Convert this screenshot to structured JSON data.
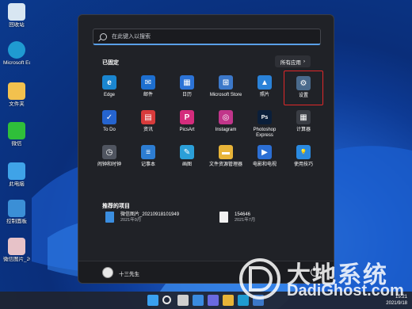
{
  "desktop": {
    "icons": [
      {
        "label": "回收站",
        "color": "#d8e6f2"
      },
      {
        "label": "Microsoft Edge",
        "color": "#1f9bd1"
      },
      {
        "label": "文件夹",
        "color": "#f2c14e"
      },
      {
        "label": "微信",
        "color": "#2fbf3a"
      },
      {
        "label": "此电脑",
        "color": "#3fa3e8"
      },
      {
        "label": "控制面板",
        "color": "#3b8fd6"
      },
      {
        "label": "微信图片_2021090",
        "color": "#e7c2c8"
      }
    ]
  },
  "start_menu": {
    "search_placeholder": "在此键入以搜索",
    "pinned_heading": "已固定",
    "all_apps_label": "所有应用",
    "all_apps_chevron": "›",
    "apps": [
      {
        "label": "Edge",
        "icon": "edge-icon",
        "color": "#1a86d0",
        "glyph": "e"
      },
      {
        "label": "邮件",
        "icon": "mail-icon",
        "color": "#1d6fd0",
        "glyph": "✉"
      },
      {
        "label": "日历",
        "icon": "calendar-icon",
        "color": "#2c73d6",
        "glyph": "▦"
      },
      {
        "label": "Microsoft Store",
        "icon": "store-icon",
        "color": "#3c78c9",
        "glyph": "⊞"
      },
      {
        "label": "照片",
        "icon": "photos-icon",
        "color": "#2a82d8",
        "glyph": "▲"
      },
      {
        "label": "设置",
        "icon": "gear-icon",
        "color": "#4a6a8c",
        "glyph": "⚙"
      },
      {
        "label": "To Do",
        "icon": "todo-icon",
        "color": "#2564cf",
        "glyph": "✓"
      },
      {
        "label": "资讯",
        "icon": "news-icon",
        "color": "#d83b3b",
        "glyph": "▤"
      },
      {
        "label": "PicsArt",
        "icon": "picsart-icon",
        "color": "#d42c7c",
        "glyph": "P"
      },
      {
        "label": "Instagram",
        "icon": "instagram-icon",
        "color": "#c1358a",
        "glyph": "◎"
      },
      {
        "label": "Photoshop Express",
        "icon": "photoshop-icon",
        "color": "#0b1f3a",
        "glyph": "Ps"
      },
      {
        "label": "计算器",
        "icon": "calculator-icon",
        "color": "#3a3d44",
        "glyph": "▦"
      },
      {
        "label": "闹钟和时钟",
        "icon": "clock-icon",
        "color": "#505560",
        "glyph": "◷"
      },
      {
        "label": "记事本",
        "icon": "notepad-icon",
        "color": "#2d7dd2",
        "glyph": "≡"
      },
      {
        "label": "画图",
        "icon": "paint-icon",
        "color": "#2b9fd8",
        "glyph": "✎"
      },
      {
        "label": "文件资源管理器",
        "icon": "folder-icon",
        "color": "#e8b438",
        "glyph": "▬"
      },
      {
        "label": "电影和电视",
        "icon": "movies-icon",
        "color": "#2c6fd4",
        "glyph": "▶"
      },
      {
        "label": "使用技巧",
        "icon": "tips-icon",
        "color": "#2a8ae0",
        "glyph": "💡"
      }
    ],
    "recommended_heading": "推荐的项目",
    "recommended": [
      {
        "name": "微信图片_20210918101949",
        "date": "2021年9月",
        "color": "#3b8ee0"
      },
      {
        "name": "154646",
        "date": "2021年7月",
        "color": "#f2f2f2"
      }
    ],
    "user_name": "十三先生"
  },
  "taskbar": {
    "items": [
      {
        "icon": "windows-icon",
        "color": "#3aa0f0"
      },
      {
        "icon": "search-icon",
        "color": "#e8e8e8"
      },
      {
        "icon": "task-view-icon",
        "color": "#cfcfcf"
      },
      {
        "icon": "widgets-icon",
        "color": "#3a8be0"
      },
      {
        "icon": "chat-icon",
        "color": "#6a6ae0"
      },
      {
        "icon": "file-explorer-icon",
        "color": "#e8b438"
      },
      {
        "icon": "edge-icon",
        "color": "#1f9bd1"
      },
      {
        "icon": "store-icon",
        "color": "#3c78c9"
      }
    ],
    "time": "15:21",
    "date": "2021/9/18"
  },
  "watermark": {
    "cn": "大地系统",
    "en": "DadiGhost.com"
  }
}
